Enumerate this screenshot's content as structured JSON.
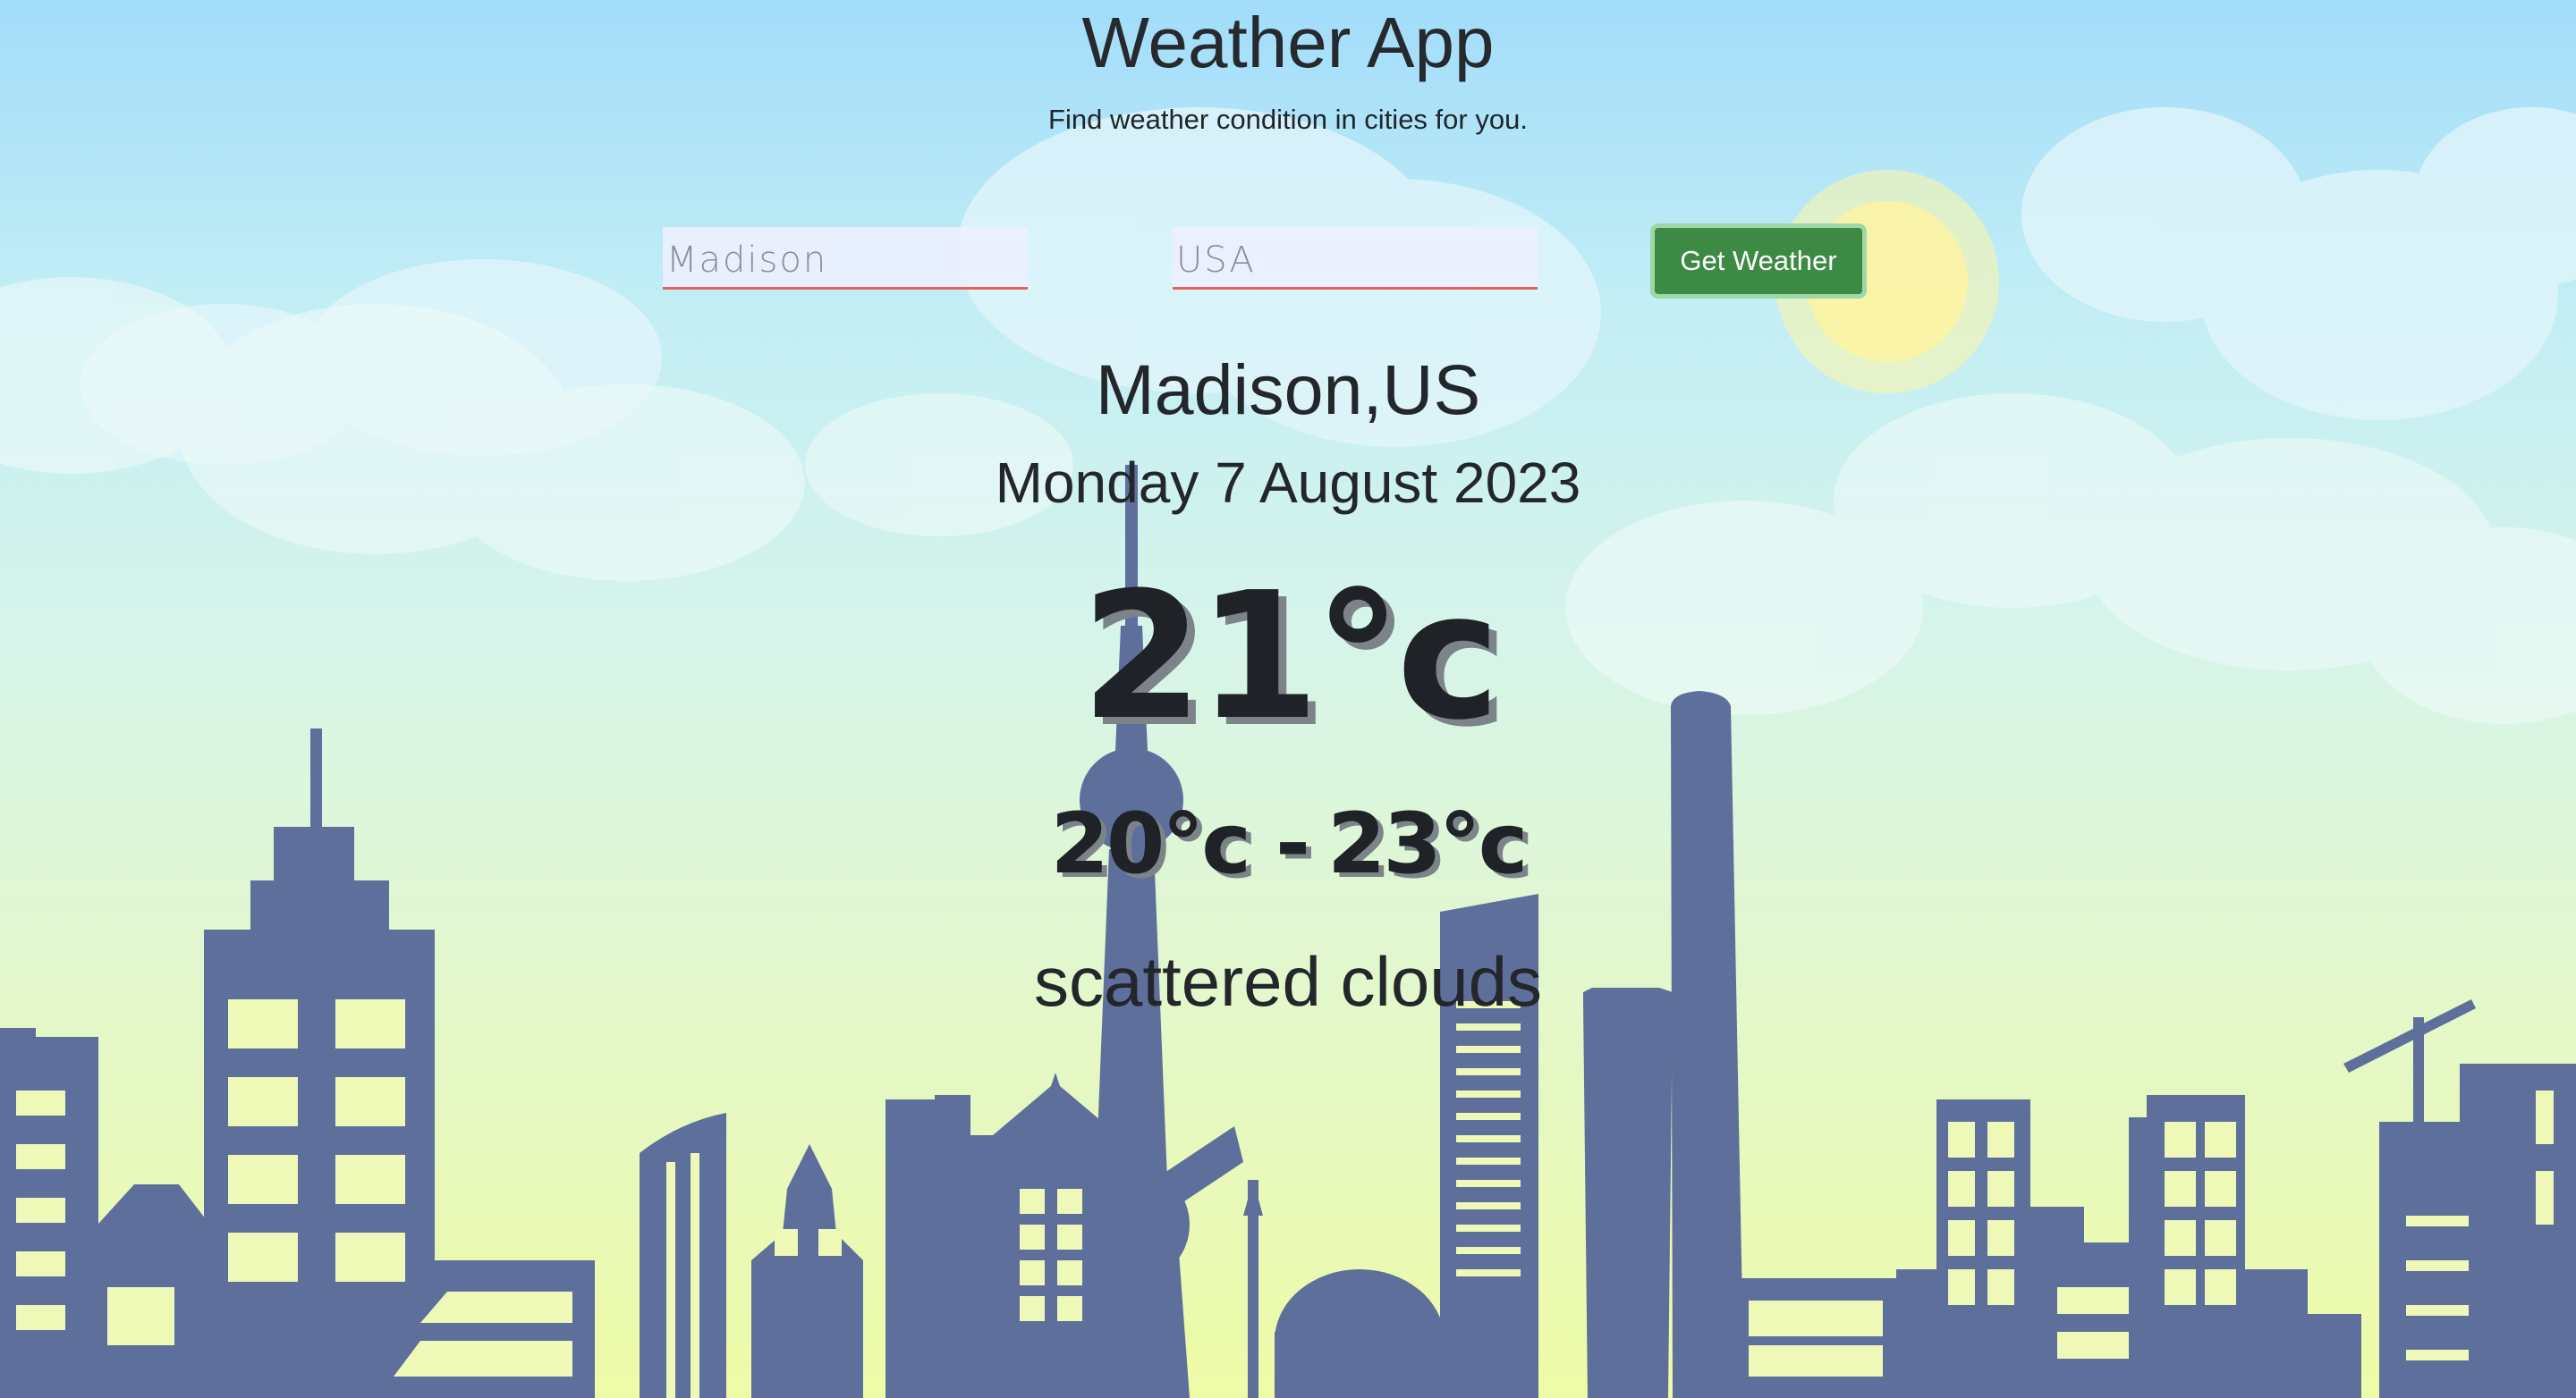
{
  "header": {
    "title": "Weather App",
    "subtitle": "Find weather condition in cities for you."
  },
  "search": {
    "city_placeholder": "Madison",
    "country_placeholder": "USA",
    "button_label": "Get Weather"
  },
  "weather": {
    "location": "Madison,US",
    "date": "Monday 7 August 2023",
    "temperature": "21°c",
    "min_temp": "20°c",
    "separator": "-",
    "max_temp": "23°c",
    "description": "scattered clouds"
  },
  "colors": {
    "button_bg": "#3d8a44",
    "button_border": "#9fd7a6",
    "input_underline": "#e0635a",
    "skyline": "#5f6f9c",
    "sun": "#fff6a8"
  },
  "icons": {
    "background": "city-skyline-illustration"
  }
}
